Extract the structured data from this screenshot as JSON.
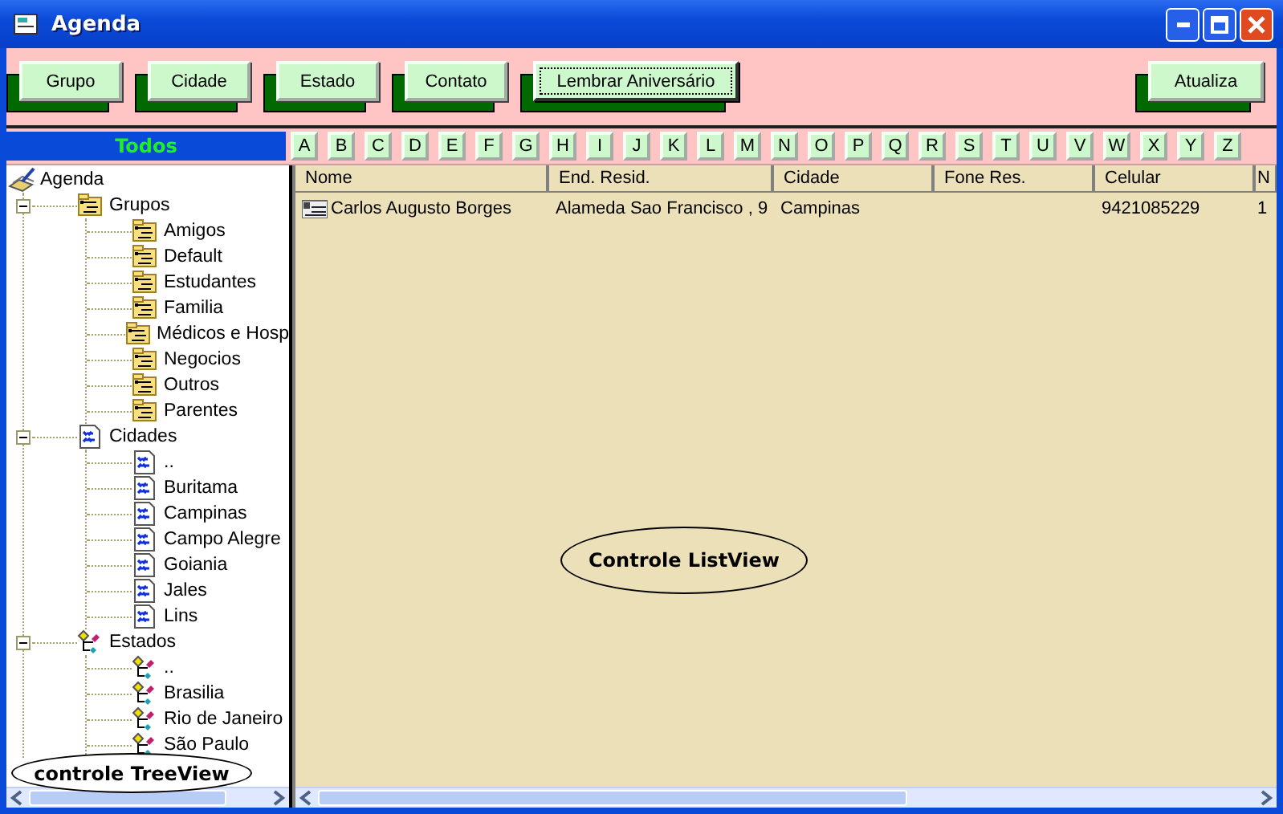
{
  "window": {
    "title": "Agenda"
  },
  "toolbar": [
    {
      "label": "Grupo",
      "focused": false
    },
    {
      "label": "Cidade",
      "focused": false
    },
    {
      "label": "Estado",
      "focused": false
    },
    {
      "label": "Contato",
      "focused": false
    },
    {
      "label": "Lembrar Aniversário",
      "focused": true
    }
  ],
  "refresh_button": {
    "label": "Atualiza"
  },
  "all_label": "Todos",
  "letters": [
    "A",
    "B",
    "C",
    "D",
    "E",
    "F",
    "G",
    "H",
    "I",
    "J",
    "K",
    "L",
    "M",
    "N",
    "O",
    "P",
    "Q",
    "R",
    "S",
    "T",
    "U",
    "V",
    "W",
    "X",
    "Y",
    "Z"
  ],
  "tree": {
    "label": "Agenda",
    "kind": "root",
    "children": [
      {
        "label": "Grupos",
        "kind": "group",
        "expanded": true,
        "children": [
          {
            "label": "Amigos",
            "kind": "group"
          },
          {
            "label": "Default",
            "kind": "group"
          },
          {
            "label": "Estudantes",
            "kind": "group"
          },
          {
            "label": "Familia",
            "kind": "group"
          },
          {
            "label": "Médicos e Hosp",
            "kind": "group"
          },
          {
            "label": "Negocios",
            "kind": "group"
          },
          {
            "label": "Outros",
            "kind": "group"
          },
          {
            "label": "Parentes",
            "kind": "group"
          }
        ]
      },
      {
        "label": "Cidades",
        "kind": "city",
        "expanded": true,
        "children": [
          {
            "label": "..",
            "kind": "city"
          },
          {
            "label": "Buritama",
            "kind": "city"
          },
          {
            "label": "Campinas",
            "kind": "city"
          },
          {
            "label": "Campo Alegre",
            "kind": "city"
          },
          {
            "label": "Goiania",
            "kind": "city"
          },
          {
            "label": "Jales",
            "kind": "city"
          },
          {
            "label": "Lins",
            "kind": "city"
          }
        ]
      },
      {
        "label": "Estados",
        "kind": "state",
        "expanded": true,
        "children": [
          {
            "label": "..",
            "kind": "state"
          },
          {
            "label": "Brasilia",
            "kind": "state"
          },
          {
            "label": "Rio de Janeiro",
            "kind": "state"
          },
          {
            "label": "São Paulo",
            "kind": "state"
          }
        ]
      }
    ]
  },
  "table": {
    "columns": [
      "Nome",
      "End. Resid.",
      "Cidade",
      "Fone Res.",
      "Celular",
      "N"
    ],
    "rows": [
      [
        "Carlos Augusto Borges",
        "Alameda Sao Francisco , 9",
        "Campinas",
        null,
        "9421085229",
        "1"
      ]
    ]
  },
  "list_callout": "Controle ListView",
  "tree_callout": "controle TreeView"
}
